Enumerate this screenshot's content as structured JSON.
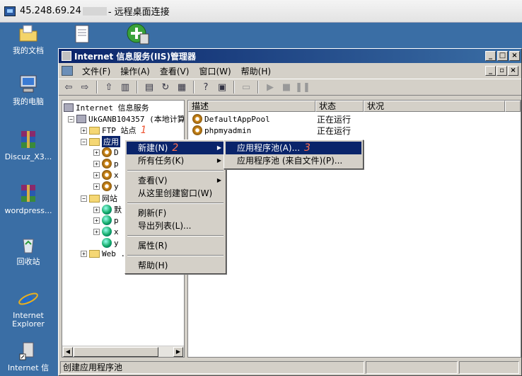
{
  "rdp": {
    "title_ip": "45.248.69.24",
    "title_suffix": "- 远程桌面连接"
  },
  "desktop_icons": [
    {
      "label": "我的文档",
      "icon": "folder-docs-icon"
    },
    {
      "label": "我的电脑",
      "icon": "computer-icon"
    },
    {
      "label": "Discuz_X3...",
      "icon": "winrar-archive-icon"
    },
    {
      "label": "wordpress...",
      "icon": "winrar-archive-icon"
    },
    {
      "label": "回收站",
      "icon": "recycle-bin-icon"
    },
    {
      "label": "Internet Explorer",
      "icon": "ie-icon"
    },
    {
      "label": "Internet 信",
      "icon": "iis-shortcut-icon"
    }
  ],
  "window": {
    "title": "Internet 信息服务(IIS)管理器",
    "menus": [
      "文件(F)",
      "操作(A)",
      "查看(V)",
      "窗口(W)",
      "帮助(H)"
    ]
  },
  "tree": {
    "root": "Internet 信息服务",
    "server": "UkGANB104357 (本地计算",
    "ftp": "FTP 站点",
    "apppools": "应用",
    "pool_children": [
      "D",
      "p",
      "x",
      "y"
    ],
    "websites": "网站",
    "site_children": [
      "默",
      "p",
      "x",
      "y"
    ],
    "web_ext": "Web .",
    "red_mark": "1"
  },
  "list": {
    "headers": [
      "描述",
      "状态",
      "状况"
    ],
    "rows": [
      {
        "name": "DefaultAppPool",
        "status": "正在运行"
      },
      {
        "name": "phpmyadmin",
        "status": "正在运行"
      }
    ]
  },
  "context_menu": {
    "items": [
      {
        "label": "新建(N)",
        "mark": "2",
        "submenu": true,
        "highlight": true
      },
      {
        "label": "所有任务(K)",
        "submenu": true
      },
      {
        "sep": true
      },
      {
        "label": "查看(V)",
        "submenu": true
      },
      {
        "label": "从这里创建窗口(W)"
      },
      {
        "sep": true
      },
      {
        "label": "刷新(F)"
      },
      {
        "label": "导出列表(L)..."
      },
      {
        "sep": true
      },
      {
        "label": "属性(R)"
      },
      {
        "sep": true
      },
      {
        "label": "帮助(H)"
      }
    ]
  },
  "sub_menu": {
    "items": [
      {
        "label": "应用程序池(A)...",
        "mark": "3",
        "highlight": true
      },
      {
        "label": "应用程序池 (来自文件)(P)..."
      }
    ]
  },
  "status": {
    "text": "创建应用程序池"
  },
  "colors": {
    "desktop": "#3a6ea5",
    "title_active": "#0a246a",
    "highlight": "#0a246a",
    "annotation": "#ee5533"
  }
}
